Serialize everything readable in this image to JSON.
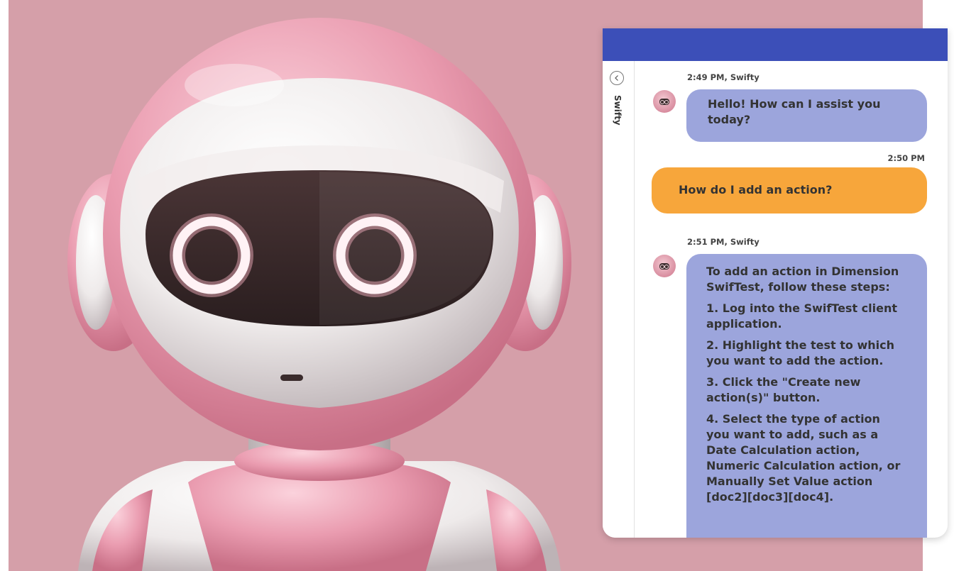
{
  "chat": {
    "panel_title": "Swifty",
    "icons": {
      "back": "chevron-left-icon",
      "avatar": "robot-avatar-icon"
    },
    "colors": {
      "header": "#3c4fb8",
      "bot_bubble": "#9ca5dc",
      "user_bubble": "#f7a63b"
    },
    "messages": [
      {
        "sender": "bot",
        "meta": "2:49 PM, Swifty",
        "paragraphs": [
          "Hello! How can I assist you today?"
        ]
      },
      {
        "sender": "user",
        "meta": "2:50 PM",
        "paragraphs": [
          "How do I add an action?"
        ]
      },
      {
        "sender": "bot",
        "meta": "2:51 PM, Swifty",
        "paragraphs": [
          "To add an action in Dimension SwifTest, follow these steps:",
          "1. Log into the SwifTest client application.",
          "2. Highlight the test to which you want to add the action.",
          "3. Click the \"Create new action(s)\" button.",
          "4. Select the type of action you want to add, such as a Date Calculation action, Numeric Calculation action, or Manually Set Value action [doc2][doc3][doc4]."
        ]
      }
    ]
  }
}
